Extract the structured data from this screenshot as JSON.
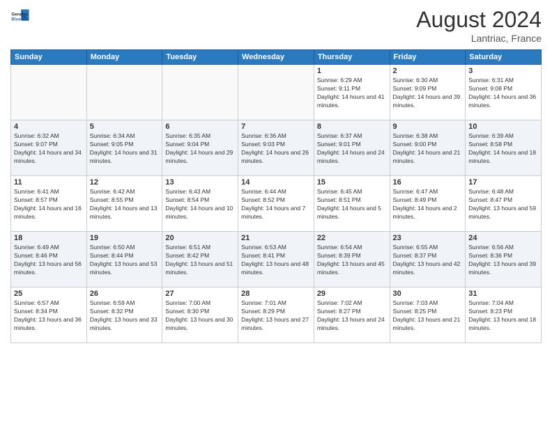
{
  "header": {
    "logo": {
      "general": "General",
      "blue": "Blue"
    },
    "month": "August 2024",
    "location": "Lantriac, France"
  },
  "weekdays": [
    "Sunday",
    "Monday",
    "Tuesday",
    "Wednesday",
    "Thursday",
    "Friday",
    "Saturday"
  ],
  "weeks": [
    [
      {
        "day": "",
        "info": ""
      },
      {
        "day": "",
        "info": ""
      },
      {
        "day": "",
        "info": ""
      },
      {
        "day": "",
        "info": ""
      },
      {
        "day": "1",
        "info": "Sunrise: 6:29 AM\nSunset: 9:11 PM\nDaylight: 14 hours and 41 minutes."
      },
      {
        "day": "2",
        "info": "Sunrise: 6:30 AM\nSunset: 9:09 PM\nDaylight: 14 hours and 39 minutes."
      },
      {
        "day": "3",
        "info": "Sunrise: 6:31 AM\nSunset: 9:08 PM\nDaylight: 14 hours and 36 minutes."
      }
    ],
    [
      {
        "day": "4",
        "info": "Sunrise: 6:32 AM\nSunset: 9:07 PM\nDaylight: 14 hours and 34 minutes."
      },
      {
        "day": "5",
        "info": "Sunrise: 6:34 AM\nSunset: 9:05 PM\nDaylight: 14 hours and 31 minutes."
      },
      {
        "day": "6",
        "info": "Sunrise: 6:35 AM\nSunset: 9:04 PM\nDaylight: 14 hours and 29 minutes."
      },
      {
        "day": "7",
        "info": "Sunrise: 6:36 AM\nSunset: 9:03 PM\nDaylight: 14 hours and 26 minutes."
      },
      {
        "day": "8",
        "info": "Sunrise: 6:37 AM\nSunset: 9:01 PM\nDaylight: 14 hours and 24 minutes."
      },
      {
        "day": "9",
        "info": "Sunrise: 6:38 AM\nSunset: 9:00 PM\nDaylight: 14 hours and 21 minutes."
      },
      {
        "day": "10",
        "info": "Sunrise: 6:39 AM\nSunset: 8:58 PM\nDaylight: 14 hours and 18 minutes."
      }
    ],
    [
      {
        "day": "11",
        "info": "Sunrise: 6:41 AM\nSunset: 8:57 PM\nDaylight: 14 hours and 16 minutes."
      },
      {
        "day": "12",
        "info": "Sunrise: 6:42 AM\nSunset: 8:55 PM\nDaylight: 14 hours and 13 minutes."
      },
      {
        "day": "13",
        "info": "Sunrise: 6:43 AM\nSunset: 8:54 PM\nDaylight: 14 hours and 10 minutes."
      },
      {
        "day": "14",
        "info": "Sunrise: 6:44 AM\nSunset: 8:52 PM\nDaylight: 14 hours and 7 minutes."
      },
      {
        "day": "15",
        "info": "Sunrise: 6:45 AM\nSunset: 8:51 PM\nDaylight: 14 hours and 5 minutes."
      },
      {
        "day": "16",
        "info": "Sunrise: 6:47 AM\nSunset: 8:49 PM\nDaylight: 14 hours and 2 minutes."
      },
      {
        "day": "17",
        "info": "Sunrise: 6:48 AM\nSunset: 8:47 PM\nDaylight: 13 hours and 59 minutes."
      }
    ],
    [
      {
        "day": "18",
        "info": "Sunrise: 6:49 AM\nSunset: 8:46 PM\nDaylight: 13 hours and 56 minutes."
      },
      {
        "day": "19",
        "info": "Sunrise: 6:50 AM\nSunset: 8:44 PM\nDaylight: 13 hours and 53 minutes."
      },
      {
        "day": "20",
        "info": "Sunrise: 6:51 AM\nSunset: 8:42 PM\nDaylight: 13 hours and 51 minutes."
      },
      {
        "day": "21",
        "info": "Sunrise: 6:53 AM\nSunset: 8:41 PM\nDaylight: 13 hours and 48 minutes."
      },
      {
        "day": "22",
        "info": "Sunrise: 6:54 AM\nSunset: 8:39 PM\nDaylight: 13 hours and 45 minutes."
      },
      {
        "day": "23",
        "info": "Sunrise: 6:55 AM\nSunset: 8:37 PM\nDaylight: 13 hours and 42 minutes."
      },
      {
        "day": "24",
        "info": "Sunrise: 6:56 AM\nSunset: 8:36 PM\nDaylight: 13 hours and 39 minutes."
      }
    ],
    [
      {
        "day": "25",
        "info": "Sunrise: 6:57 AM\nSunset: 8:34 PM\nDaylight: 13 hours and 36 minutes."
      },
      {
        "day": "26",
        "info": "Sunrise: 6:59 AM\nSunset: 8:32 PM\nDaylight: 13 hours and 33 minutes."
      },
      {
        "day": "27",
        "info": "Sunrise: 7:00 AM\nSunset: 8:30 PM\nDaylight: 13 hours and 30 minutes."
      },
      {
        "day": "28",
        "info": "Sunrise: 7:01 AM\nSunset: 8:29 PM\nDaylight: 13 hours and 27 minutes."
      },
      {
        "day": "29",
        "info": "Sunrise: 7:02 AM\nSunset: 8:27 PM\nDaylight: 13 hours and 24 minutes."
      },
      {
        "day": "30",
        "info": "Sunrise: 7:03 AM\nSunset: 8:25 PM\nDaylight: 13 hours and 21 minutes."
      },
      {
        "day": "31",
        "info": "Sunrise: 7:04 AM\nSunset: 8:23 PM\nDaylight: 13 hours and 18 minutes."
      }
    ]
  ]
}
